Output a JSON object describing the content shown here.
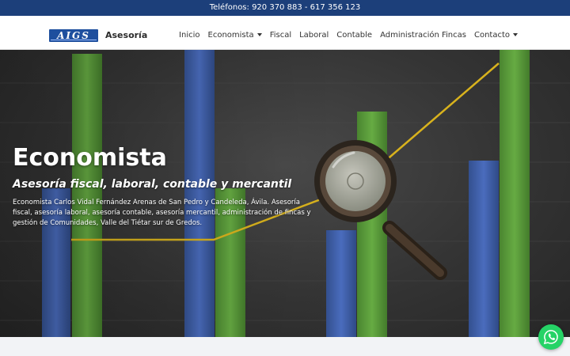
{
  "topbar": {
    "phones": "Teléfonos: 920 370 883 - 617 356 123"
  },
  "header": {
    "logo_text": "AIGS",
    "brand": "Asesoría",
    "menu": [
      {
        "label": "Inicio",
        "has_dropdown": false
      },
      {
        "label": "Economista",
        "has_dropdown": true
      },
      {
        "label": "Fiscal",
        "has_dropdown": false
      },
      {
        "label": "Laboral",
        "has_dropdown": false
      },
      {
        "label": "Contable",
        "has_dropdown": false
      },
      {
        "label": "Administración Fincas",
        "has_dropdown": false
      },
      {
        "label": "Contacto",
        "has_dropdown": true
      }
    ]
  },
  "hero": {
    "title": "Economista",
    "subtitle": "Asesoría fiscal, laboral, contable y mercantil",
    "text": "Economista Carlos Vidal Fernández Arenas de San Pedro y Candeleda, Ávila. Asesoría fiscal, asesoría laboral, asesoría contable, asesoría mercantil, administración de fincas y gestión de Comunidades, Valle del Tiétar sur de Gredos."
  },
  "icons": {
    "whatsapp": "whatsapp-icon",
    "magnifier": "magnifying-glass-icon",
    "dropdown": "chevron-down-icon"
  },
  "colors": {
    "topbar_bg": "#1c3f7a",
    "bar_blue": "#3f5ea8",
    "bar_green": "#5a9a3a",
    "trend_line": "#d8b21d",
    "whatsapp": "#25d366"
  }
}
